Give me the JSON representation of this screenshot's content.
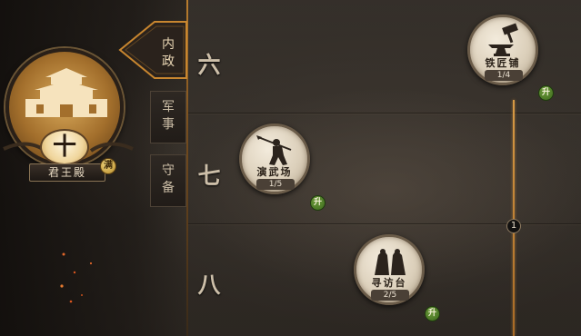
{
  "palace": {
    "level": "十",
    "name": "君王殿",
    "badge": "满"
  },
  "tabs": [
    {
      "label": "内政",
      "active": true
    },
    {
      "label": "军事",
      "active": false
    },
    {
      "label": "守备",
      "active": false
    }
  ],
  "rows": [
    {
      "level": "六"
    },
    {
      "level": "七"
    },
    {
      "level": "八"
    }
  ],
  "buildings": [
    {
      "name": "铁匠铺",
      "progress": "1/4",
      "upgrade": "升",
      "icon": "anvil-hammer-icon"
    },
    {
      "name": "演武场",
      "progress": "1/5",
      "upgrade": "升",
      "icon": "spear-warrior-icon"
    },
    {
      "name": "寻访台",
      "progress": "2/5",
      "upgrade": "升",
      "icon": "cloaked-figures-icon"
    }
  ],
  "connector": {
    "label": "1"
  },
  "colors": {
    "accent": "#c8862f",
    "upgrade_green": "#4f7f2a",
    "node_face": "#e6dccb"
  }
}
